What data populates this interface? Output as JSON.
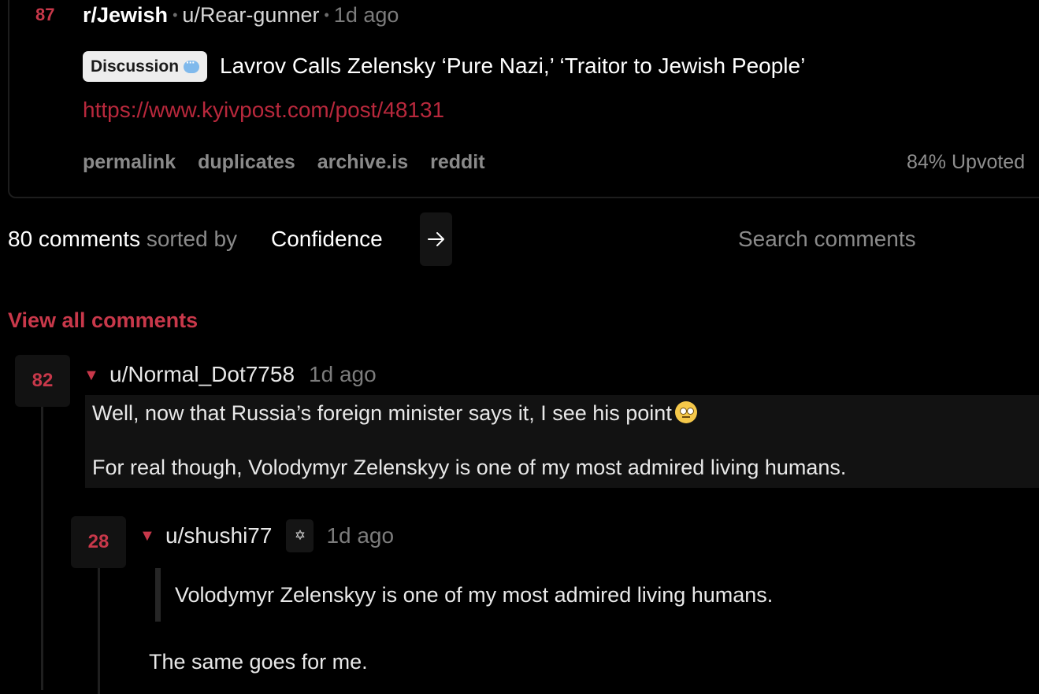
{
  "post": {
    "score": "87",
    "subreddit": "r/Jewish",
    "author": "u/Rear-gunner",
    "time": "1d ago",
    "flair": "Discussion",
    "flair_icon": "speech-bubble-icon",
    "title": "Lavrov Calls Zelensky ‘Pure Nazi,’ ‘Traitor to Jewish People’",
    "link": "https://www.kyivpost.com/post/48131",
    "actions": [
      "permalink",
      "duplicates",
      "archive.is",
      "reddit"
    ],
    "upvoted": "84% Upvoted"
  },
  "comments_bar": {
    "count": "80 comments",
    "sorted_by": "sorted by",
    "sort_value": "Confidence",
    "go_icon": "arrow-right-icon",
    "search_placeholder": "Search comments"
  },
  "view_all": "View all comments",
  "comments": [
    {
      "score": "82",
      "author": "u/Normal_Dot7758",
      "time": "1d ago",
      "paragraphs": [
        "Well, now that Russia’s foreign minister says it, I see his point",
        "For real though, Volodymyr Zelenskyy is one of my most admired living humans."
      ],
      "emoji": "eye-roll-emoji"
    },
    {
      "score": "28",
      "author": "u/shushi77",
      "flair": "✡",
      "time": "1d ago",
      "quote": "Volodymyr Zelenskyy is one of my most admired living humans.",
      "text": "The same goes for me."
    }
  ],
  "colors": {
    "background": "#000000",
    "accent": "#c8384a",
    "link": "#b8283c",
    "muted": "#8a8a8a"
  }
}
